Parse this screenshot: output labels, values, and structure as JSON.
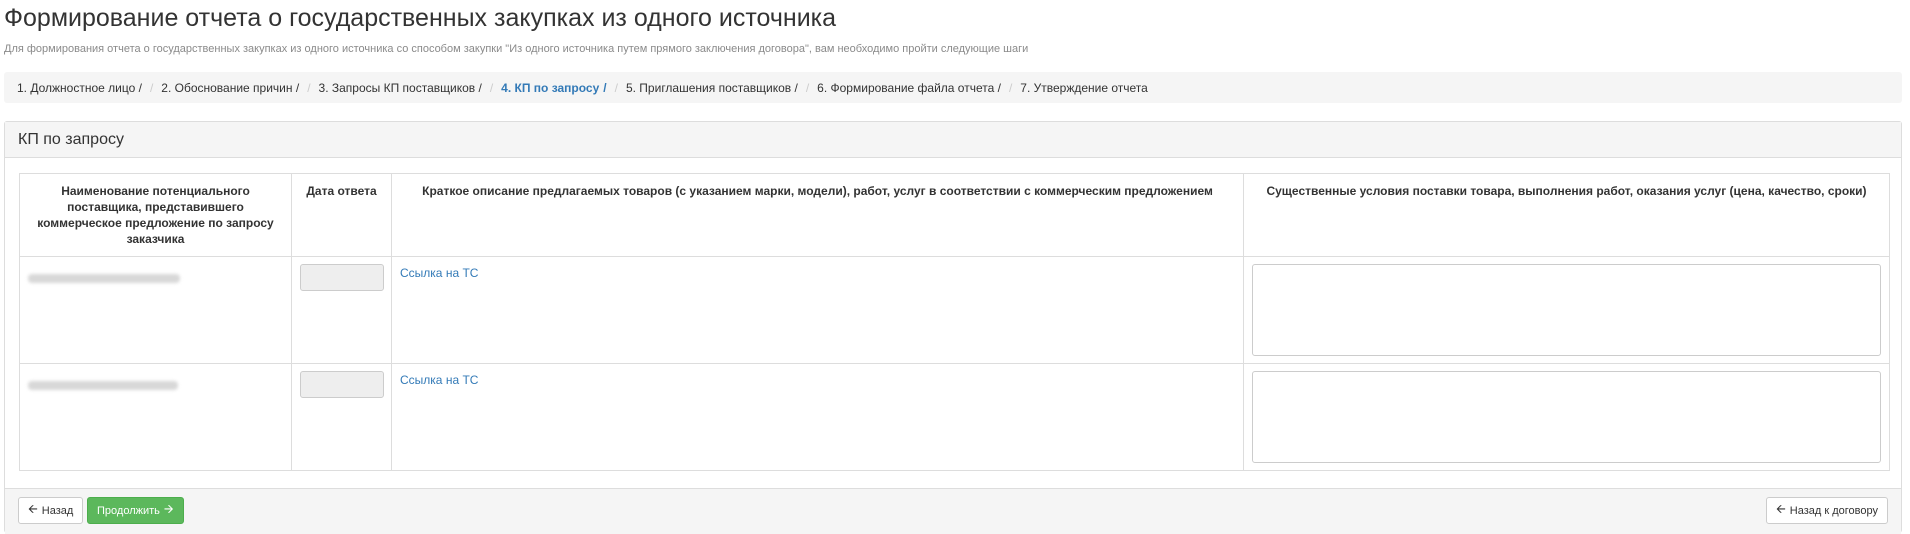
{
  "page": {
    "title": "Формирование отчета о государственных закупках из одного источника",
    "subtitle": "Для формирования отчета о государственных закупках из одного источника со способом закупки \"Из одного источника путем прямого заключения договора\", вам необходимо пройти следующие шаги"
  },
  "breadcrumb": [
    {
      "label": "1. Должностное лицо /",
      "active": false
    },
    {
      "label": "2. Обоснование причин /",
      "active": false
    },
    {
      "label": "3. Запросы КП поставщиков /",
      "active": false
    },
    {
      "label": "4. КП по запросу",
      "active": true
    },
    {
      "label": "5. Приглашения поставщиков /",
      "active": false
    },
    {
      "label": "6. Формирование файла отчета /",
      "active": false
    },
    {
      "label": "7. Утверждение отчета",
      "active": false
    }
  ],
  "breadcrumb_separator": "/",
  "panel": {
    "heading": "КП по запросу"
  },
  "table": {
    "headers": [
      "Наименование потенциального поставщика, представившего коммерческое предложение по запросу заказчика",
      "Дата ответа",
      "Краткое описание предлагаемых товаров (с указанием марки, модели), работ, услуг в соответствии с коммерческим предложением",
      "Существенные условия поставки товара, выполнения работ, оказания услуг (цена, качество, сроки)"
    ],
    "rows": [
      {
        "date": "",
        "link_label": "Ссылка на ТС",
        "conditions": ""
      },
      {
        "date": "",
        "link_label": "Ссылка на ТС",
        "conditions": ""
      }
    ]
  },
  "footer": {
    "back_label": "Назад",
    "continue_label": "Продолжить",
    "back_to_contract_label": "Назад к договору"
  },
  "colors": {
    "link": "#337ab7",
    "success": "#5cb85c",
    "panel_bg": "#f5f5f5",
    "border": "#dddddd"
  },
  "icons": {
    "back": "arrow-left-icon",
    "continue": "arrow-right-icon",
    "back_to_contract": "arrow-left-icon"
  }
}
